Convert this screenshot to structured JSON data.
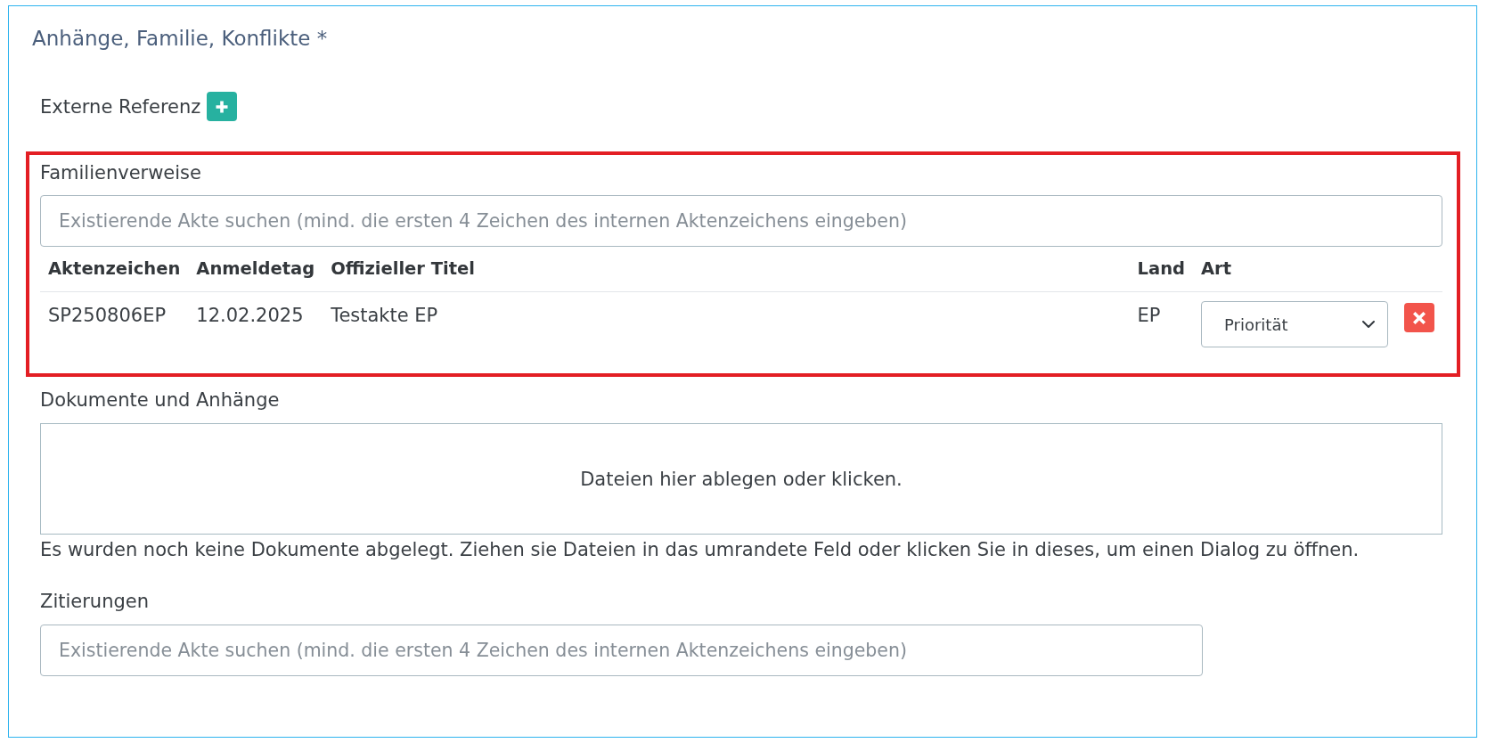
{
  "panel": {
    "title": "Anhänge, Familie, Konflikte *"
  },
  "external_reference": {
    "label": "Externe Referenz"
  },
  "family_references": {
    "label": "Familienverweise",
    "highlighted": true,
    "search": {
      "placeholder": "Existierende Akte suchen (mind. die ersten 4 Zeichen des internen Aktenzeichens eingeben)"
    },
    "table": {
      "columns": [
        "Aktenzeichen",
        "Anmeldetag",
        "Offizieller Titel",
        "Land",
        "Art"
      ],
      "rows": [
        {
          "cells": [
            "SP250806EP",
            "12.02.2025",
            "Testakte EP",
            "EP"
          ],
          "type_select": {
            "value": "Priorität"
          }
        }
      ]
    }
  },
  "documents": {
    "label": "Dokumente und Anhänge",
    "dropzone_text": "Dateien hier ablegen oder klicken.",
    "hint": "Es wurden noch keine Dokumente abgelegt. Ziehen sie Dateien in das umrandete Feld oder klicken Sie in dieses, um einen Dialog zu öffnen."
  },
  "citations": {
    "label": "Zitierungen",
    "search": {
      "placeholder": "Existierende Akte suchen (mind. die ersten 4 Zeichen des internen Aktenzeichens eingeben)"
    }
  }
}
